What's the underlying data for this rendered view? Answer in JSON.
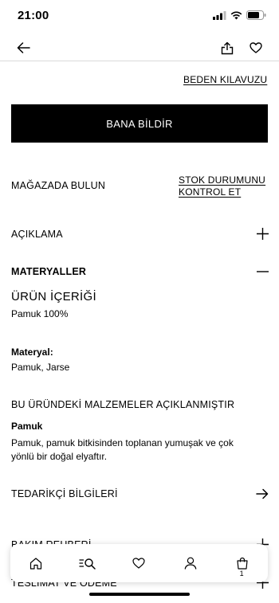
{
  "status_bar": {
    "time": "21:00"
  },
  "size_guide": {
    "label": "BEDEN KILAVUZU"
  },
  "notify_button": {
    "label": "BANA BİLDİR"
  },
  "find_in_store": {
    "label": "MAĞAZADA BULUN",
    "stock_link_line1": "STOK DURUMUNU",
    "stock_link_line2": "KONTROL ET"
  },
  "sections": {
    "description": {
      "label": "AÇIKLAMA"
    },
    "materials": {
      "label": "MATERYALLER",
      "content_title": "ÜRÜN İÇERİĞİ",
      "content_value": "Pamuk 100%",
      "material_label": "Materyal:",
      "material_value": "Pamuk, Jarse",
      "disclosure_title": "BU ÜRÜNDEKİ MALZEMELER AÇIKLANMIŞTIR",
      "fiber_name": "Pamuk",
      "fiber_description_line1": "Pamuk, pamuk bitkisinden toplanan yumuşak ve çok",
      "fiber_description_line2": "yönlü bir doğal elyaftır."
    },
    "supplier": {
      "label": "TEDARİKÇİ BİLGİLERİ"
    },
    "care_guide": {
      "label": "BAKIM REHBERİ"
    },
    "shipping": {
      "label": "TESLİMAT VE ÖDEME"
    }
  },
  "bottom_nav": {
    "items": [
      {
        "icon": "home-icon"
      },
      {
        "icon": "search-menu-icon"
      },
      {
        "icon": "heart-icon"
      },
      {
        "icon": "user-icon"
      },
      {
        "icon": "shopping-bag-icon",
        "count": "1"
      }
    ]
  }
}
